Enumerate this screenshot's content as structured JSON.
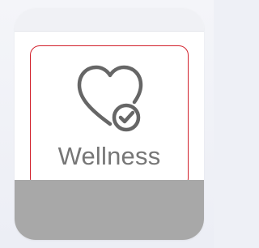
{
  "tile": {
    "label": "Wellness",
    "icon": "heart-check-icon"
  },
  "colors": {
    "selection_outline": "#d21f2a",
    "icon_stroke": "#666666",
    "label_text": "#767676",
    "bottom_band": "#a8a8a8"
  }
}
